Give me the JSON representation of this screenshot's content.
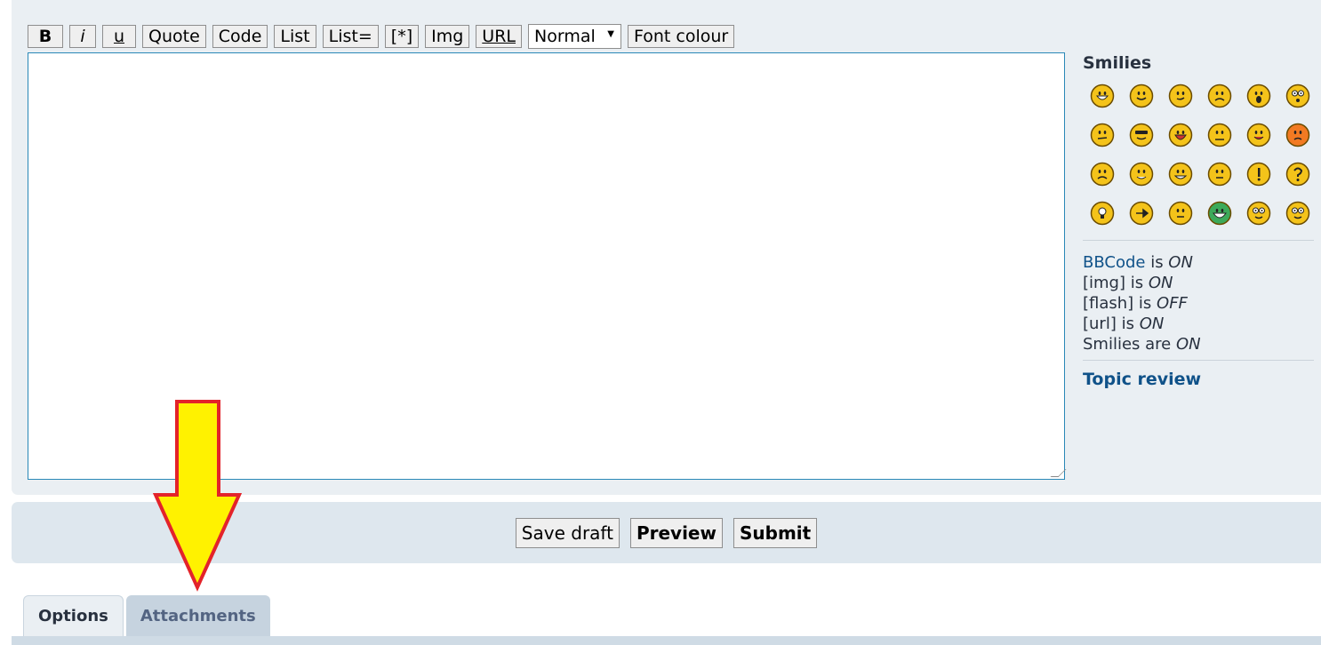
{
  "toolbar": {
    "bold": "B",
    "italic": "i",
    "underline": "u",
    "quote": "Quote",
    "code": "Code",
    "list": "List",
    "list_ordered": "List=",
    "list_item": "[*]",
    "img": "Img",
    "url": "URL",
    "font_size": "Normal",
    "font_colour": "Font colour"
  },
  "editor": {
    "value": ""
  },
  "sidebar": {
    "smilies_heading": "Smilies",
    "smilies": [
      {
        "face": "#f4c31a",
        "mouth": "grin"
      },
      {
        "face": "#f4c31a",
        "mouth": "smile"
      },
      {
        "face": "#f4c31a",
        "mouth": "wink"
      },
      {
        "face": "#f4c31a",
        "mouth": "sad"
      },
      {
        "face": "#f4c31a",
        "mouth": "shock"
      },
      {
        "face": "#f4c31a",
        "mouth": "eek"
      },
      {
        "face": "#f4c31a",
        "mouth": "confused"
      },
      {
        "face": "#f4c31a",
        "mouth": "cool"
      },
      {
        "face": "#f4c31a",
        "mouth": "lol"
      },
      {
        "face": "#f4c31a",
        "mouth": "mad"
      },
      {
        "face": "#f4c31a",
        "mouth": "razz"
      },
      {
        "face": "#f27a22",
        "mouth": "angry"
      },
      {
        "face": "#f4c31a",
        "mouth": "cry"
      },
      {
        "face": "#f4c31a",
        "mouth": "evil"
      },
      {
        "face": "#f4c31a",
        "mouth": "twisted"
      },
      {
        "face": "#f4c31a",
        "mouth": "roll"
      },
      {
        "face": "#f4c31a",
        "mouth": "exclaim"
      },
      {
        "face": "#f4c31a",
        "mouth": "question"
      },
      {
        "face": "#f4c31a",
        "mouth": "idea"
      },
      {
        "face": "#f4c31a",
        "mouth": "arrow"
      },
      {
        "face": "#f4c31a",
        "mouth": "neutral"
      },
      {
        "face": "#3caa5a",
        "mouth": "mrgreen"
      },
      {
        "face": "#f4c31a",
        "mouth": "geek"
      },
      {
        "face": "#f4c31a",
        "mouth": "ugeek"
      }
    ],
    "bbcode_link": "BBCode",
    "bbcode_is": " is ",
    "bbcode_state": "ON",
    "img_label": "[img] is ",
    "img_state": "ON",
    "flash_label": "[flash] is ",
    "flash_state": "OFF",
    "url_label": "[url] is ",
    "url_state": "ON",
    "smilies_label": "Smilies are ",
    "smilies_state": "ON",
    "topic_review": "Topic review"
  },
  "actions": {
    "save_draft": "Save draft",
    "preview": "Preview",
    "submit": "Submit"
  },
  "tabs": [
    {
      "label": "Options",
      "active": true
    },
    {
      "label": "Attachments",
      "active": false
    }
  ],
  "overlay": {
    "arrow_fill": "#fff200",
    "arrow_stroke": "#e3232a"
  }
}
